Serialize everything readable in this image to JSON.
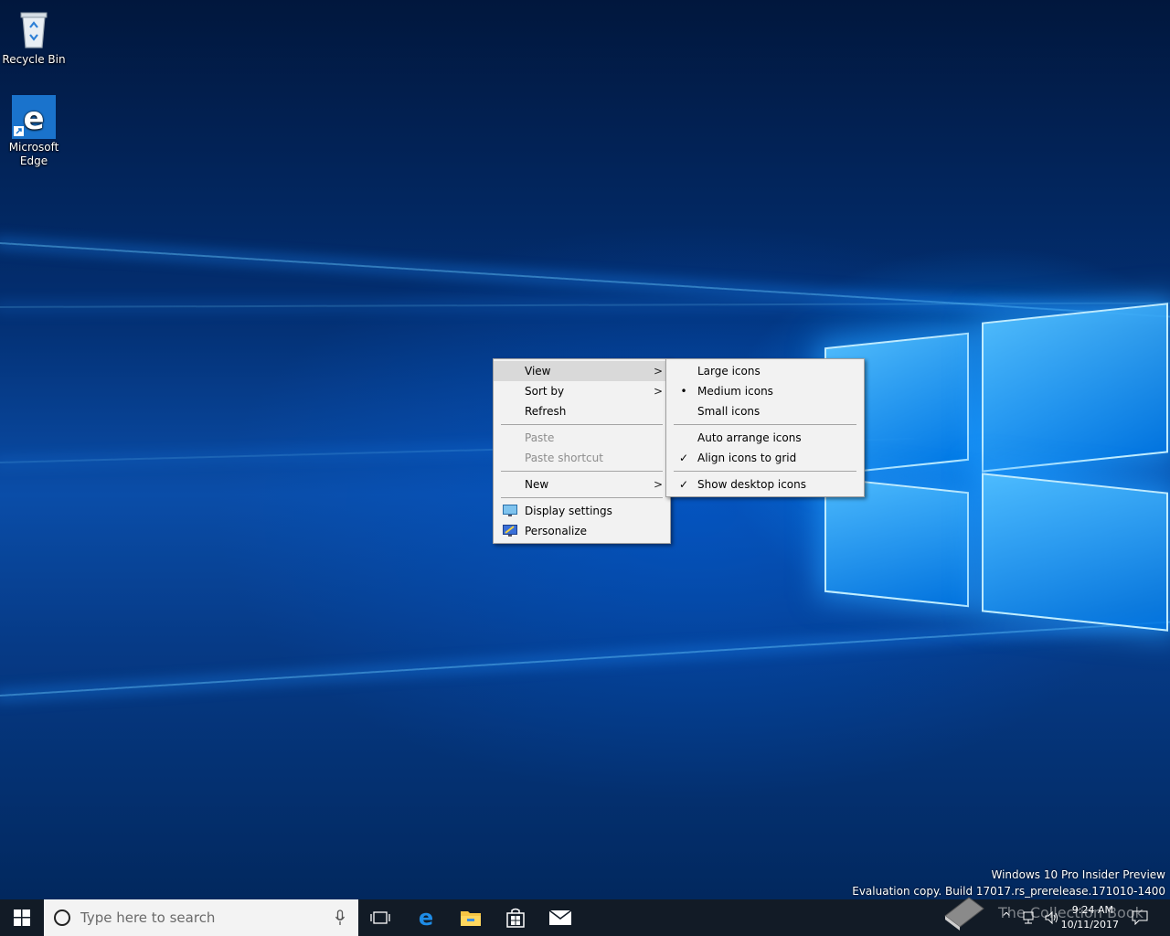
{
  "desktop": {
    "icons": [
      {
        "label": "Recycle Bin"
      },
      {
        "label": "Microsoft Edge",
        "line1": "Microsoft",
        "line2": "Edge"
      }
    ],
    "watermark": {
      "line1": "Windows 10 Pro Insider Preview",
      "line2": "Evaluation copy. Build 17017.rs_prerelease.171010-1400"
    }
  },
  "context_menu": {
    "items": [
      {
        "label": "View",
        "submenu": true,
        "highlighted": true
      },
      {
        "label": "Sort by",
        "submenu": true
      },
      {
        "label": "Refresh"
      },
      {
        "label": "Paste",
        "disabled": true
      },
      {
        "label": "Paste shortcut",
        "disabled": true
      },
      {
        "label": "New",
        "submenu": true
      },
      {
        "label": "Display settings",
        "icon": "display-settings-icon"
      },
      {
        "label": "Personalize",
        "icon": "personalize-icon"
      }
    ]
  },
  "view_submenu": {
    "items": [
      {
        "label": "Large icons"
      },
      {
        "label": "Medium icons",
        "mark": "•"
      },
      {
        "label": "Small icons"
      },
      {
        "label": "Auto arrange icons"
      },
      {
        "label": "Align icons to grid",
        "mark": "✓"
      },
      {
        "label": "Show desktop icons",
        "mark": "✓"
      }
    ]
  },
  "taskbar": {
    "search_placeholder": "Type here to search",
    "pinned": [
      "edge-icon",
      "file-explorer-icon",
      "store-icon",
      "mail-icon"
    ],
    "clock": {
      "time": "9:24 AM",
      "date": "10/11/2017"
    },
    "overlay_text": "The Collection Book"
  },
  "colors": {
    "accent": "#0078d7",
    "taskbar": "#121b26",
    "menu_bg": "#f2f2f2",
    "menu_highlight": "#d9d9d9"
  }
}
